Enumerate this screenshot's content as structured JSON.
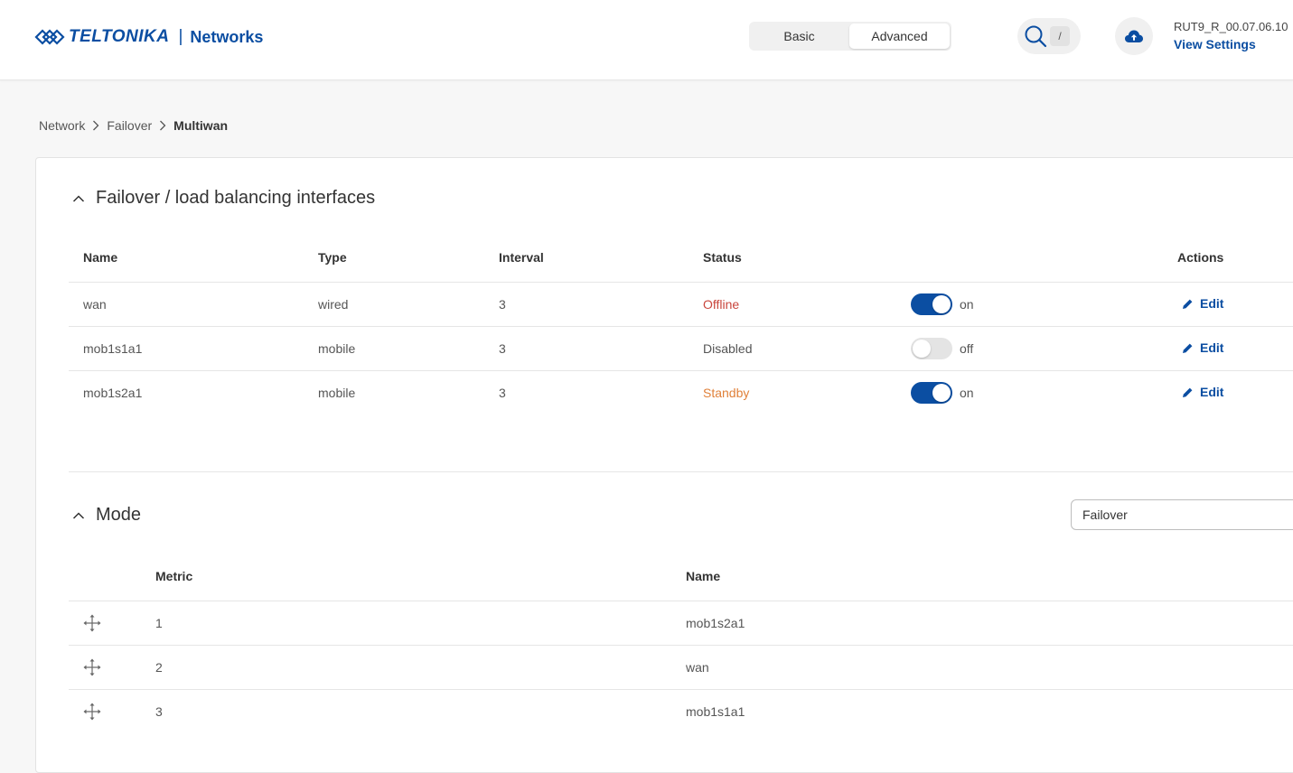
{
  "header": {
    "brand": "TELTONIKA",
    "brand_separator": "|",
    "brand_sub": "Networks",
    "mode_basic": "Basic",
    "mode_advanced": "Advanced",
    "search_shortcut": "/",
    "device_name": "RUT9_R_00.07.06.10",
    "view_settings": "View Settings"
  },
  "breadcrumb": {
    "items": [
      "Network",
      "Failover",
      "Multiwan"
    ]
  },
  "interfaces": {
    "title": "Failover / load balancing interfaces",
    "columns": {
      "name": "Name",
      "type": "Type",
      "interval": "Interval",
      "status": "Status",
      "actions": "Actions"
    },
    "rows": [
      {
        "name": "wan",
        "type": "wired",
        "interval": "3",
        "status": "Offline",
        "switch": "on",
        "edit": "Edit"
      },
      {
        "name": "mob1s1a1",
        "type": "mobile",
        "interval": "3",
        "status": "Disabled",
        "switch": "off",
        "edit": "Edit"
      },
      {
        "name": "mob1s2a1",
        "type": "mobile",
        "interval": "3",
        "status": "Standby",
        "switch": "on",
        "edit": "Edit"
      }
    ]
  },
  "mode": {
    "title": "Mode",
    "selected": "Failover",
    "columns": {
      "metric": "Metric",
      "name": "Name"
    },
    "rows": [
      {
        "metric": "1",
        "name": "mob1s2a1"
      },
      {
        "metric": "2",
        "name": "wan"
      },
      {
        "metric": "3",
        "name": "mob1s1a1"
      }
    ]
  },
  "colors": {
    "accent": "#0b4ea2",
    "offline": "#c9463d",
    "standby": "#e0813a"
  },
  "icons": [
    "teltonika-logo-icon",
    "search-icon",
    "cloud-upload-icon",
    "chevron-right-icon",
    "chevron-up-icon",
    "pencil-icon",
    "drag-move-icon"
  ]
}
